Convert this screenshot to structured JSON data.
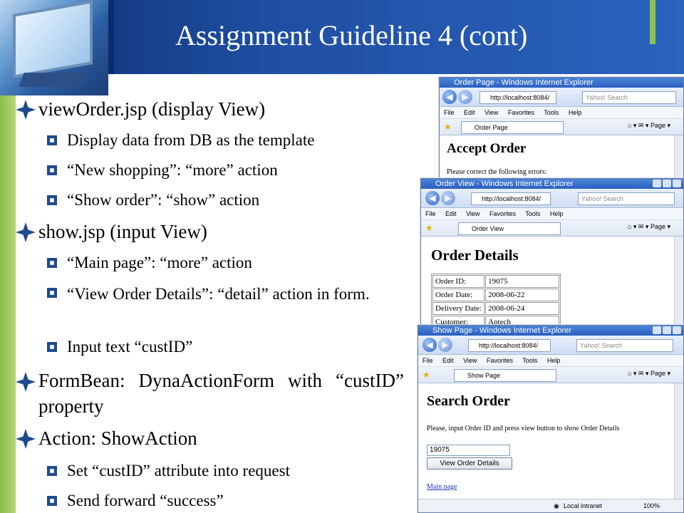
{
  "slide": {
    "title": "Assignment Guideline 4 (cont)",
    "bullets": [
      {
        "level": 1,
        "text": "viewOrder.jsp (display View)"
      },
      {
        "level": 2,
        "text": "Display data from DB as the template"
      },
      {
        "level": 2,
        "text": "“New shopping”: “more” action"
      },
      {
        "level": 2,
        "text": "“Show order”: “show” action"
      },
      {
        "level": 1,
        "text": "show.jsp (input View)"
      },
      {
        "level": 2,
        "text": "“Main page”: “more” action"
      },
      {
        "level": 2,
        "text": "“View Order Details”: “detail” action in form."
      },
      {
        "level": 2,
        "text": "Input text “custID”"
      },
      {
        "level": 1,
        "text": "FormBean: DynaActionForm with “custID” property"
      },
      {
        "level": 1,
        "text": "Action: ShowAction"
      },
      {
        "level": 2,
        "text": "Set “custID” attribute into request"
      },
      {
        "level": 2,
        "text": "Send forward “success”"
      }
    ]
  },
  "browser": {
    "address": "http://localhost:8084/",
    "search_placeholder": "Yahoo! Search",
    "menu": [
      "File",
      "Edit",
      "View",
      "Favorites",
      "Tools",
      "Help"
    ],
    "page_menu": "Page"
  },
  "window1": {
    "title": "Order Page - Windows Internet Explorer",
    "tab": "Order Page",
    "heading": "Accept Order",
    "text": "Please correct the following errors:"
  },
  "window2": {
    "title": "Order View - Windows Internet Explorer",
    "tab": "Order View",
    "heading": "Order Details",
    "rows": [
      {
        "label": "Order ID:",
        "value": "19075"
      },
      {
        "label": "Order Date:",
        "value": "2008-06-22"
      },
      {
        "label": "Delivery Date:",
        "value": "2008-06-24"
      },
      {
        "label": "Customer:",
        "value": "Aptech"
      }
    ]
  },
  "window3": {
    "title": "Show Page - Windows Internet Explorer",
    "tab": "Show Page",
    "heading": "Search Order",
    "instruction": "Please, input Order ID and press view button to show Order Details",
    "input_value": "19075",
    "button": "View Order Details",
    "link": "Main page",
    "status_zone": "Local intranet",
    "zoom": "100%"
  },
  "colors": {
    "title_bar": "#1f4fa3",
    "accent_green": "#8dc34e",
    "ie_titlebar": "#2a5fbf"
  }
}
